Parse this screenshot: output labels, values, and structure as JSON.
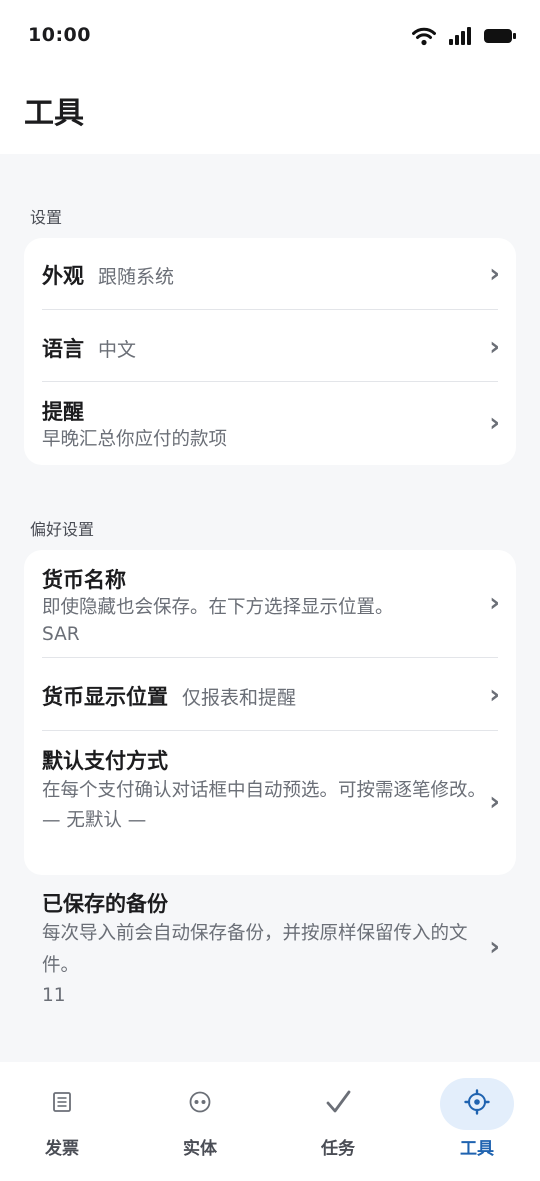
{
  "status_bar": {
    "time": "10:00"
  },
  "header": {
    "title": "工具"
  },
  "sections": {
    "settings": {
      "label": "设置",
      "appearance": {
        "title": "外观",
        "value": "跟随系统"
      },
      "language": {
        "title": "语言",
        "value": "中文"
      },
      "reminder": {
        "title": "提醒",
        "subtitle": "早晚汇总你应付的款项"
      }
    },
    "preferences": {
      "label": "偏好设置",
      "currency_name": {
        "title": "货币名称",
        "subtitle": "即使隐藏也会保存。在下方选择显示位置。",
        "value": "SAR"
      },
      "currency_position": {
        "title": "货币显示位置",
        "value": "仅报表和提醒"
      },
      "default_payment": {
        "title": "默认支付方式",
        "subtitle": "在每个支付确认对话框中自动预选。可按需逐笔修改。",
        "value": "— 无默认 —"
      }
    },
    "backups": {
      "title": "已保存的备份",
      "subtitle": "每次导入前会自动保存备份，并按原样保留传入的文件。",
      "count": "11"
    }
  },
  "chevron_glyph": "›",
  "bottom_nav": {
    "items": [
      {
        "label": "发票",
        "icon": "receipt-icon"
      },
      {
        "label": "实体",
        "icon": "entity-icon"
      },
      {
        "label": "任务",
        "icon": "check-icon"
      },
      {
        "label": "工具",
        "icon": "gear-icon"
      }
    ],
    "active": "工具",
    "active_color": "#1f63b0",
    "active_bg": "#e3eefb"
  }
}
